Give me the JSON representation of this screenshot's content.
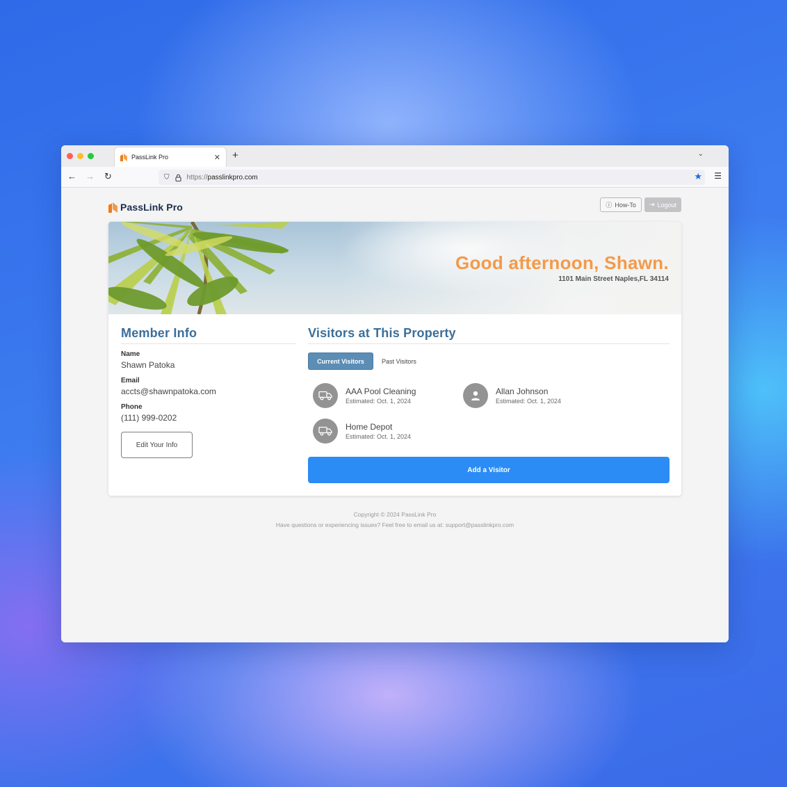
{
  "browser": {
    "tab_title": "PassLink Pro",
    "url_proto": "https://",
    "url_host": "passlinkpro.com"
  },
  "brand": {
    "name": "PassLink Pro",
    "accent": "#f39a4a",
    "logo_color": "#f07a1a"
  },
  "header": {
    "howto_label": "How-To",
    "logout_label": "Logout"
  },
  "hero": {
    "greeting": "Good afternoon, Shawn.",
    "address": "1101 Main Street Naples,FL 34114"
  },
  "member": {
    "title": "Member Info",
    "name_label": "Name",
    "name_value": "Shawn Patoka",
    "email_label": "Email",
    "email_value": "accts@shawnpatoka.com",
    "phone_label": "Phone",
    "phone_value": "(111) 999-0202",
    "edit_label": "Edit Your Info"
  },
  "visitors": {
    "title": "Visitors at This Property",
    "tabs": [
      "Current Visitors",
      "Past Visitors"
    ],
    "list": [
      {
        "name": "AAA Pool Cleaning",
        "date": "Estimated: Oct. 1, 2024",
        "icon": "truck-icon"
      },
      {
        "name": "Allan Johnson",
        "date": "Estimated: Oct. 1, 2024",
        "icon": "person-icon"
      },
      {
        "name": "Home Depot",
        "date": "Estimated: Oct. 1, 2024",
        "icon": "truck-icon"
      }
    ],
    "add_label": "Add a Visitor"
  },
  "footer": {
    "copyright": "Copyright © 2024 PassLink Pro",
    "support": "Have questions or experiencing issues? Feel free to email us at: support@passlinkpro.com"
  }
}
